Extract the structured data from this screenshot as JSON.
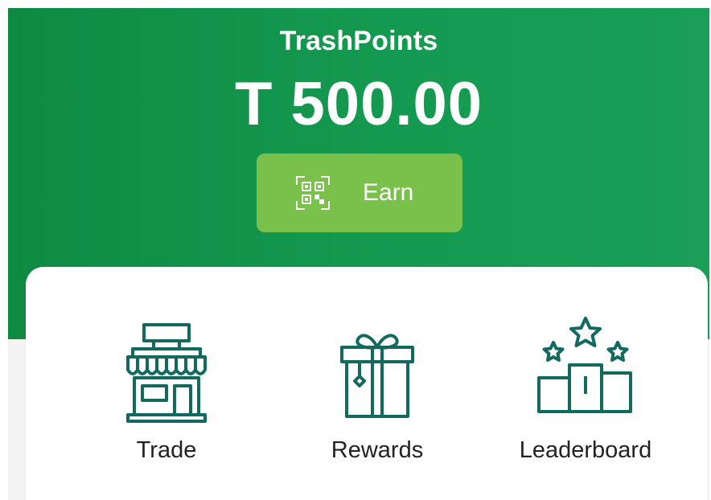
{
  "header": {
    "title": "TrashPoints",
    "balance": "T 500.00"
  },
  "earn_button": {
    "label": "Earn",
    "icon": "qr-scan-icon"
  },
  "actions": [
    {
      "label": "Trade",
      "icon": "storefront-icon"
    },
    {
      "label": "Rewards",
      "icon": "gift-box-icon"
    },
    {
      "label": "Leaderboard",
      "icon": "podium-stars-icon"
    }
  ],
  "colors": {
    "header_green": "#0f8a43",
    "button_green": "#79c14a",
    "icon_teal": "#13695e"
  }
}
